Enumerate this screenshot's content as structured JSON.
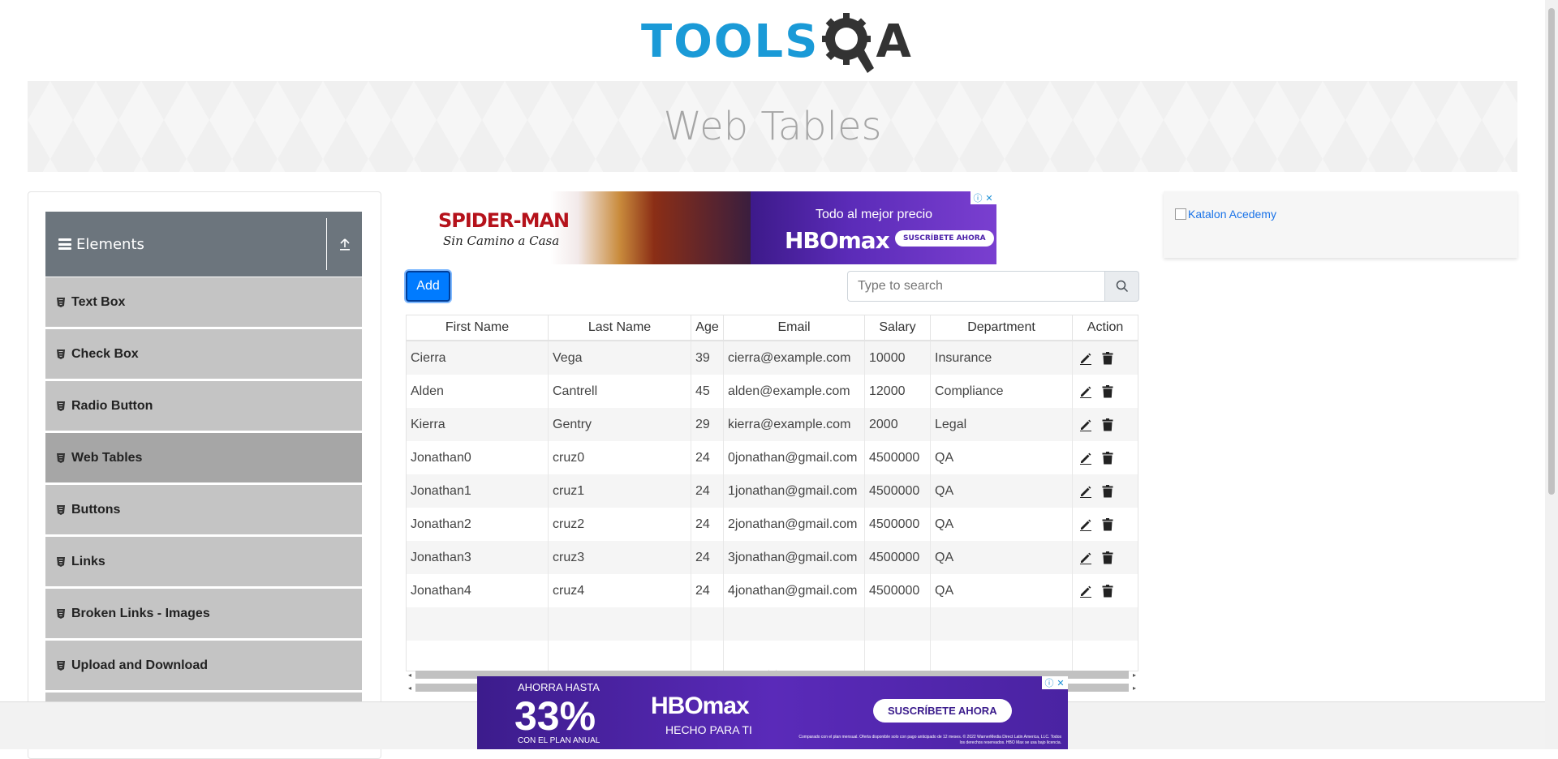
{
  "header": {
    "logo_tools": "TOOLS",
    "logo_a": "A",
    "page_title": "Web Tables"
  },
  "sidebar": {
    "group_title": "Elements",
    "items": [
      {
        "label": "Text Box"
      },
      {
        "label": "Check Box"
      },
      {
        "label": "Radio Button"
      },
      {
        "label": "Web Tables",
        "active": true
      },
      {
        "label": "Buttons"
      },
      {
        "label": "Links"
      },
      {
        "label": "Broken Links - Images"
      },
      {
        "label": "Upload and Download"
      }
    ]
  },
  "ad_top": {
    "movie": "SPIDER-MAN",
    "tagline": "Sin Camino a Casa",
    "offer": "Todo al mejor precio",
    "brand": "HBOmax",
    "cta": "SUSCRÍBETE AHORA"
  },
  "toolbar": {
    "add_label": "Add",
    "search_placeholder": "Type to search"
  },
  "table": {
    "headers": [
      "First Name",
      "Last Name",
      "Age",
      "Email",
      "Salary",
      "Department",
      "Action"
    ],
    "rows": [
      [
        "Cierra",
        "Vega",
        "39",
        "cierra@example.com",
        "10000",
        "Insurance"
      ],
      [
        "Alden",
        "Cantrell",
        "45",
        "alden@example.com",
        "12000",
        "Compliance"
      ],
      [
        "Kierra",
        "Gentry",
        "29",
        "kierra@example.com",
        "2000",
        "Legal"
      ],
      [
        "Jonathan0",
        "cruz0",
        "24",
        "0jonathan@gmail.com",
        "4500000",
        "QA"
      ],
      [
        "Jonathan1",
        "cruz1",
        "24",
        "1jonathan@gmail.com",
        "4500000",
        "QA"
      ],
      [
        "Jonathan2",
        "cruz2",
        "24",
        "2jonathan@gmail.com",
        "4500000",
        "QA"
      ],
      [
        "Jonathan3",
        "cruz3",
        "24",
        "3jonathan@gmail.com",
        "4500000",
        "QA"
      ],
      [
        "Jonathan4",
        "cruz4",
        "24",
        "4jonathan@gmail.com",
        "4500000",
        "QA"
      ]
    ]
  },
  "right_ad": {
    "alt_text": "Katalon Acedemy"
  },
  "ad_bottom": {
    "line1": "AHORRA HASTA",
    "big": "33%",
    "line3": "CON EL PLAN ANUAL",
    "brand": "HBOmax",
    "slogan": "HECHO PARA TI",
    "cta": "SUSCRÍBETE AHORA",
    "fine_print": "Comparado con el plan mensual. Oferta disponible solo con pago anticipado de 12 meses. © 2022 WarnerMedia Direct Latin America, LLC. Todos los derechos reservados. HBO Max se usa bajo licencia."
  },
  "colors": {
    "brand_blue": "#1a9ad7",
    "primary_button": "#007bff",
    "sidebar_header": "#6c757d",
    "sidebar_item": "#c4c4c4",
    "sidebar_active": "#a6a6a6"
  }
}
